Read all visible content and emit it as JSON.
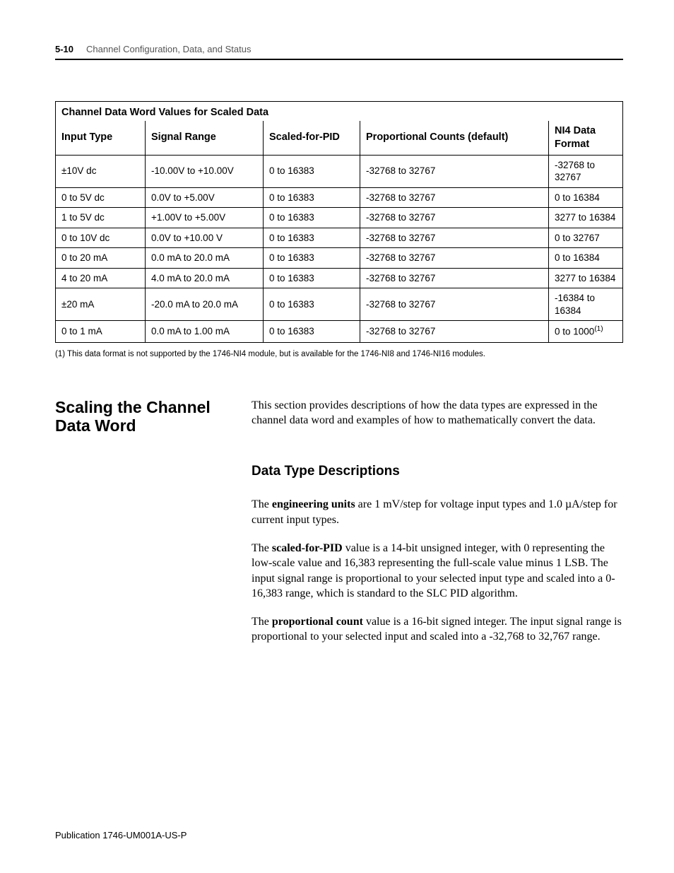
{
  "header": {
    "page_number": "5-10",
    "chapter_title": "Channel Configuration, Data, and Status"
  },
  "table": {
    "title": "Channel Data Word Values for Scaled Data",
    "columns": [
      "Input Type",
      "Signal Range",
      "Scaled-for-PID",
      "Proportional Counts (default)",
      "NI4 Data Format"
    ],
    "rows": [
      [
        "±10V dc",
        "-10.00V to +10.00V",
        "0 to 16383",
        "-32768 to 32767",
        "-32768 to 32767"
      ],
      [
        "0 to 5V dc",
        "0.0V to +5.00V",
        "0 to 16383",
        "-32768 to 32767",
        "0 to 16384"
      ],
      [
        "1 to 5V dc",
        "+1.00V to +5.00V",
        "0 to 16383",
        "-32768 to 32767",
        "3277 to 16384"
      ],
      [
        "0 to 10V dc",
        "0.0V to +10.00 V",
        "0 to 16383",
        "-32768 to 32767",
        "0 to 32767"
      ],
      [
        "0 to 20 mA",
        "0.0 mA to 20.0 mA",
        "0 to 16383",
        "-32768 to 32767",
        "0 to 16384"
      ],
      [
        "4 to 20 mA",
        "4.0 mA to 20.0 mA",
        "0 to 16383",
        "-32768 to 32767",
        "3277 to 16384"
      ],
      [
        "±20 mA",
        "-20.0 mA to 20.0 mA",
        "0 to 16383",
        "-32768 to 32767",
        "-16384 to 16384"
      ],
      [
        "0 to 1 mA",
        "0.0 mA to 1.00 mA",
        "0 to 16383",
        "-32768 to 32767",
        "0 to 1000"
      ]
    ],
    "last_cell_sup": "(1)",
    "footnote": "(1)   This data format is not supported by the 1746-NI4 module, but is available for the 1746-NI8 and 1746-NI16 modules."
  },
  "section": {
    "heading": "Scaling the Channel Data Word",
    "intro": "This section provides descriptions of how the data types are expressed in the channel data word and examples of how to mathematically convert the data.",
    "subheading": "Data Type Descriptions",
    "p1_pre": "The ",
    "p1_bold": "engineering units",
    "p1_post": " are 1 mV/step for voltage input types and 1.0 µA/step for current input types.",
    "p2_pre": "The ",
    "p2_bold": "scaled-for-PID",
    "p2_post": " value is a 14-bit unsigned integer, with 0 representing the low-scale value and 16,383 representing the full-scale value minus 1 LSB. The input signal range is proportional to your selected input type and scaled into a 0-16,383 range, which is standard to the SLC PID algorithm.",
    "p3_pre": "The ",
    "p3_bold": "proportional count",
    "p3_post": " value is a 16-bit signed integer. The input signal range is proportional to your selected input and scaled into a -32,768 to 32,767 range."
  },
  "footer": {
    "publication": "Publication 1746-UM001A-US-P"
  }
}
